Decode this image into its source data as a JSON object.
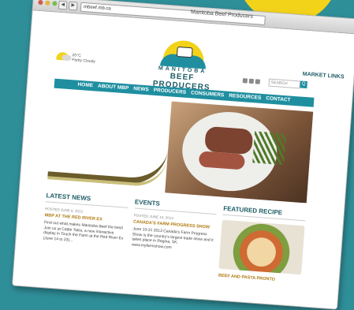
{
  "browser": {
    "title": "Manitoba Beef Producers",
    "url": "mbeef.mb.ca",
    "back_label": "◀",
    "forward_label": "▶"
  },
  "header": {
    "weather_temp": "20°C",
    "weather_desc": "Partly Cloudy",
    "logo_top": "MANITOBA",
    "logo_bottom": "BEEF PRODUCERS",
    "market_links": "MARKET LINKS",
    "search_placeholder": "SEARCH",
    "search_button": "Q"
  },
  "nav": [
    "HOME",
    "ABOUT MBP",
    "NEWS",
    "PRODUCERS",
    "CONSUMERS",
    "RESOURCES",
    "CONTACT"
  ],
  "columns": {
    "news": {
      "title": "LATEST NEWS",
      "date": "POSTED JUNE 8, 2013",
      "headline": "MBP AT THE RED RIVER EX",
      "text": "Find out what makes Manitoba Beef the best! Join us at Cattle Tales, a new interactive display in Touch the Farm at the Red River Ex (June 14 to 23)..."
    },
    "events": {
      "title": "EVENTS",
      "date": "POSTED JUNE 15, 2013",
      "headline": "CANADA'S FARM PROGRESS SHOW",
      "text": "June 19-21 2013 Canada's Farm Progress Show is the country's largest trade show and it takes place in Regina, SK. www.myfarmshow.com"
    },
    "recipe": {
      "title": "FEATURED RECIPE",
      "headline": "BEEF AND PASTA PRONTO"
    }
  },
  "colors": {
    "teal": "#1f8fa0",
    "yellow": "#f3d31a",
    "gold": "#b07a11",
    "background": "#2f8f99"
  }
}
